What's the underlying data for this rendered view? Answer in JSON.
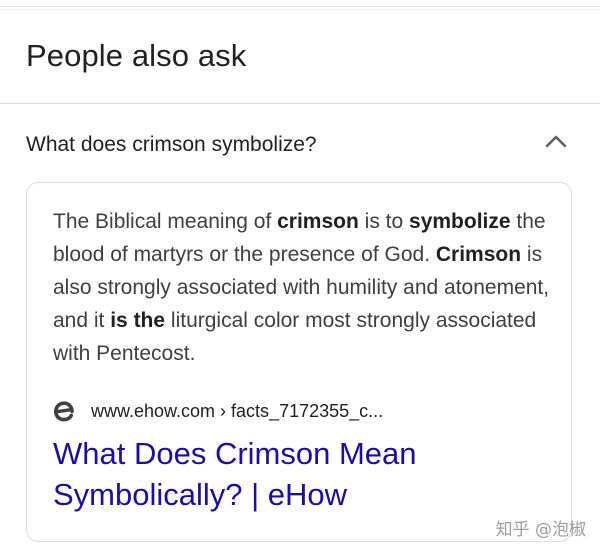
{
  "section": {
    "title": "People also ask"
  },
  "question": {
    "text": "What does crimson symbolize?",
    "expanded": true,
    "chevron_icon": "chevron-up-icon"
  },
  "answer": {
    "segments": [
      {
        "text": "The Biblical meaning of ",
        "bold": false
      },
      {
        "text": "crimson",
        "bold": true
      },
      {
        "text": " is to ",
        "bold": false
      },
      {
        "text": "symbolize",
        "bold": true
      },
      {
        "text": " the blood of martyrs or the presence of God. ",
        "bold": false
      },
      {
        "text": "Crimson",
        "bold": true
      },
      {
        "text": " is also strongly associated with humility and atonement, and it ",
        "bold": false
      },
      {
        "text": "is the",
        "bold": true
      },
      {
        "text": " liturgical color most strongly associated with Pentecost.",
        "bold": false
      }
    ]
  },
  "source": {
    "favicon_icon": "ehow-logo-icon",
    "url": "www.ehow.com › facts_7172355_c...",
    "title_line1": "What Does Crimson Mean",
    "title_line2": "Symbolically? | eHow",
    "link_color": "#1a0dab"
  },
  "watermark": {
    "text": "知乎 @泡椒"
  }
}
